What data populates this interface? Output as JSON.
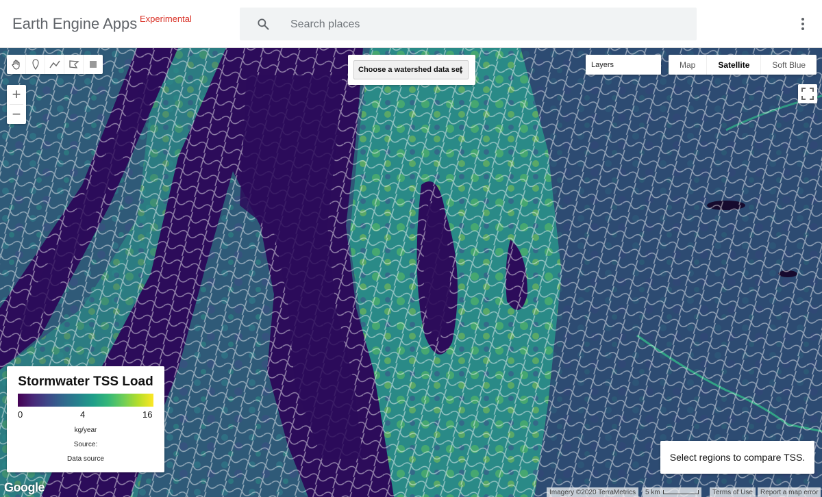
{
  "header": {
    "brand": "Earth Engine Apps",
    "brand_tag": "Experimental",
    "search_placeholder": "Search places",
    "search_icon": "search-icon",
    "menu_icon": "more-vert-icon"
  },
  "map": {
    "drawing_tools": [
      {
        "name": "pan-hand-icon"
      },
      {
        "name": "marker-icon"
      },
      {
        "name": "line-icon"
      },
      {
        "name": "polygon-icon"
      },
      {
        "name": "rectangle-icon"
      }
    ],
    "zoom_in": "+",
    "zoom_out": "−",
    "dataset_select": "Choose a watershed data set",
    "layers_label": "Layers",
    "map_types": [
      {
        "label": "Map",
        "active": false
      },
      {
        "label": "Satellite",
        "active": true
      },
      {
        "label": "Soft Blue",
        "active": false
      }
    ],
    "fullscreen_icon": "fullscreen-icon"
  },
  "legend": {
    "title": "Stormwater TSS Load",
    "min": "0",
    "mid": "4",
    "max": "16",
    "units": "kg/year",
    "source_label": "Source:",
    "source_link": "Data source",
    "palette": [
      "#440154",
      "#3e4989",
      "#26828e",
      "#35b779",
      "#fde725"
    ]
  },
  "info_panel": {
    "text": "Select regions to compare TSS."
  },
  "footer": {
    "google_logo": "Google",
    "imagery": "Imagery ©2020 TerraMetrics",
    "scale": "5 km",
    "terms": "Terms of Use",
    "report": "Report a map error"
  }
}
